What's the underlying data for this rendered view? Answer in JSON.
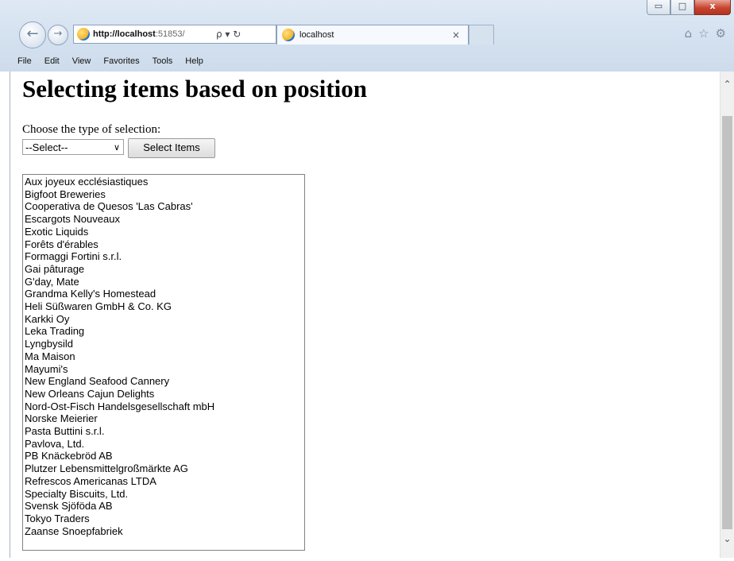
{
  "browser": {
    "url_host": "http://localhost",
    "url_rest": ":51853/",
    "address_controls": "ρ ▾ ↻",
    "tab_title": "localhost",
    "tab_close": "×",
    "window_controls": {
      "minimize": "▭",
      "maximize": "□",
      "close": "x"
    },
    "menu": [
      "File",
      "Edit",
      "View",
      "Favorites",
      "Tools",
      "Help"
    ]
  },
  "page": {
    "title": "Selecting items based on position",
    "prompt": "Choose the type of selection:",
    "select_value": "--Select--",
    "button_label": "Select Items",
    "items": [
      "Aux joyeux ecclésiastiques",
      "Bigfoot Breweries",
      "Cooperativa de Quesos 'Las Cabras'",
      "Escargots Nouveaux",
      "Exotic Liquids",
      "Forêts d'érables",
      "Formaggi Fortini s.r.l.",
      "Gai pâturage",
      "G'day, Mate",
      "Grandma Kelly's Homestead",
      "Heli Süßwaren GmbH & Co. KG",
      "Karkki Oy",
      "Leka Trading",
      "Lyngbysild",
      "Ma Maison",
      "Mayumi's",
      "New England Seafood Cannery",
      "New Orleans Cajun Delights",
      "Nord-Ost-Fisch Handelsgesellschaft mbH",
      "Norske Meierier",
      "Pasta Buttini s.r.l.",
      "Pavlova, Ltd.",
      "PB Knäckebröd AB",
      "Plutzer Lebensmittelgroßmärkte AG",
      "Refrescos Americanas LTDA",
      "Specialty Biscuits, Ltd.",
      "Svensk Sjöföda AB",
      "Tokyo Traders",
      "Zaanse Snoepfabriek"
    ]
  }
}
